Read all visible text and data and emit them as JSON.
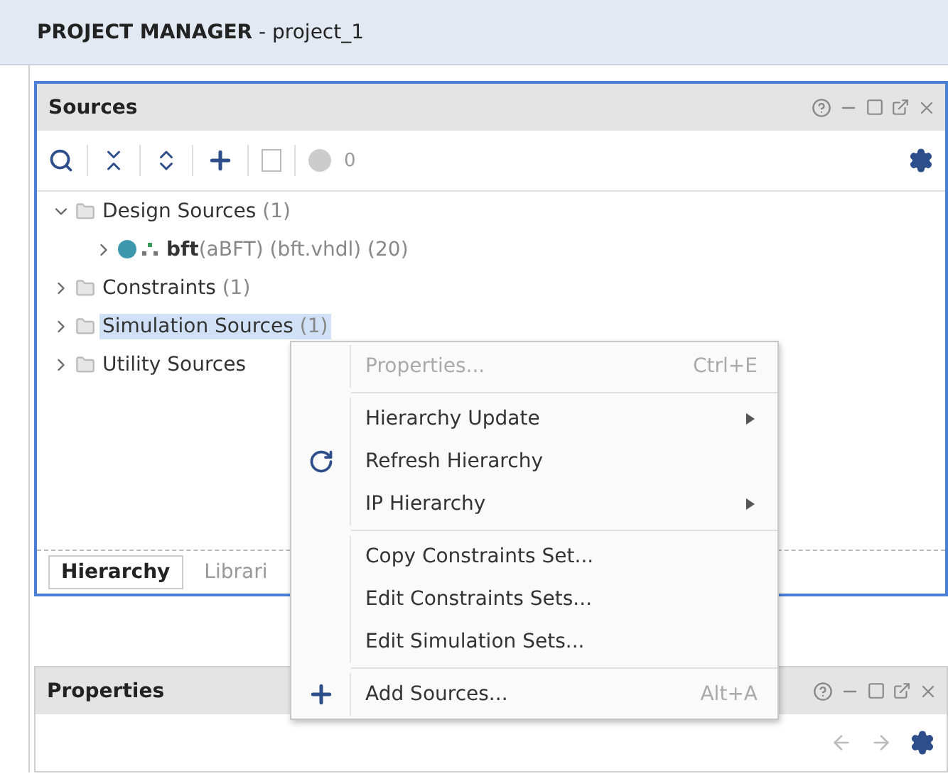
{
  "window": {
    "title": "**PROJECT MANAGER** - project_1"
  },
  "sources": {
    "title": "Sources",
    "toolbar": {
      "count": "0"
    },
    "tree": [
      {
        "label": "Design Sources",
        "count": "(1)",
        "expanded": true,
        "selected": false,
        "kind": "folder",
        "children": [
          {
            "label": "bft",
            "detail": "(aBFT) (bft.vhdl) (20)",
            "expanded": false,
            "selected": false,
            "kind": "module"
          }
        ]
      },
      {
        "label": "Constraints",
        "count": "(1)",
        "expanded": false,
        "selected": false,
        "kind": "folder"
      },
      {
        "label": "Simulation Sources",
        "count": "(1)",
        "expanded": false,
        "selected": true,
        "kind": "folder"
      },
      {
        "label": "Utility Sources",
        "expanded": false,
        "selected": false,
        "kind": "folder"
      }
    ],
    "tabs": [
      {
        "label": "Hierarchy",
        "selected": true
      },
      {
        "label": "Librari",
        "selected": false
      }
    ]
  },
  "properties": {
    "title": "Properties"
  },
  "context_menu": [
    {
      "kind": "item",
      "label": "Properties...",
      "shortcut": "Ctrl+E",
      "disabled": true
    },
    {
      "kind": "separator"
    },
    {
      "kind": "item",
      "label": "Hierarchy Update",
      "submenu": true,
      "disabled": false
    },
    {
      "kind": "refresh",
      "label": "Refresh Hierarchy",
      "disabled": false
    },
    {
      "kind": "item",
      "label": "IP Hierarchy",
      "submenu": true,
      "disabled": false
    },
    {
      "kind": "separator"
    },
    {
      "kind": "item",
      "label": "Copy Constraints Set...",
      "disabled": false
    },
    {
      "kind": "item",
      "label": "Edit Constraints Sets...",
      "disabled": false
    },
    {
      "kind": "item",
      "label": "Edit Simulation Sets...",
      "disabled": false
    },
    {
      "kind": "separator"
    },
    {
      "kind": "add",
      "label": "Add Sources...",
      "shortcut": "Alt+A",
      "disabled": false
    }
  ]
}
